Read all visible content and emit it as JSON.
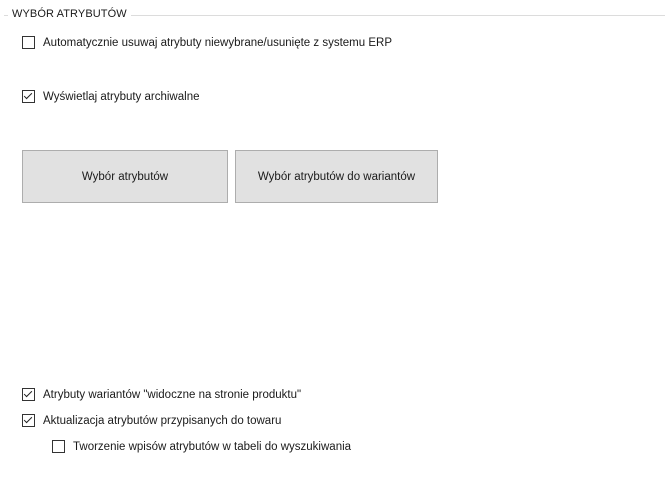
{
  "group": {
    "title": "WYBÓR ATRYBUTÓW"
  },
  "options": {
    "auto_remove": {
      "label": "Automatycznie usuwaj atrybuty niewybrane/usunięte z systemu ERP",
      "checked": false
    },
    "show_archived": {
      "label": "Wyświetlaj atrybuty archiwalne",
      "checked": true
    },
    "variant_visible": {
      "label": "Atrybuty wariantów \"widoczne na stronie produktu\"",
      "checked": true
    },
    "update_assigned": {
      "label": "Aktualizacja atrybutów przypisanych do towaru",
      "checked": true
    },
    "search_index": {
      "label": "Tworzenie wpisów atrybutów w tabeli do wyszukiwania",
      "checked": false
    }
  },
  "buttons": {
    "select_attributes": "Wybór atrybutów",
    "select_variant_attributes": "Wybór atrybutów do wariantów"
  }
}
